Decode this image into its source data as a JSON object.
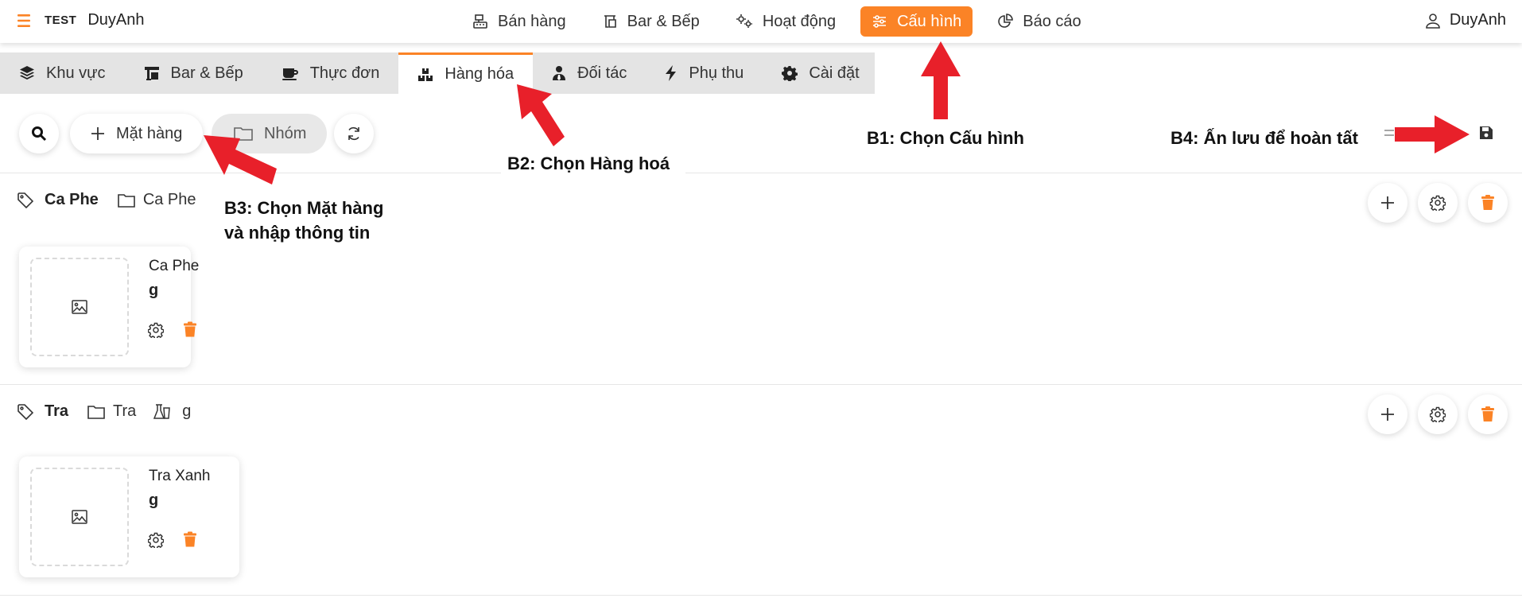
{
  "header": {
    "tag": "TEST",
    "store_name": "DuyAnh",
    "nav": [
      {
        "label": "Bán hàng",
        "icon": "cash-register-icon",
        "active": false
      },
      {
        "label": "Bar & Bếp",
        "icon": "kitchen-icon",
        "active": false
      },
      {
        "label": "Hoạt động",
        "icon": "gears-icon",
        "active": false
      },
      {
        "label": "Cấu hình",
        "icon": "sliders-icon",
        "active": true
      },
      {
        "label": "Báo cáo",
        "icon": "pie-chart-icon",
        "active": false
      }
    ],
    "user_label": "DuyAnh"
  },
  "tabs": [
    {
      "label": "Khu vực",
      "icon": "layers-icon",
      "active": false
    },
    {
      "label": "Bar & Bếp",
      "icon": "kitchen-icon",
      "active": false
    },
    {
      "label": "Thực đơn",
      "icon": "coffee-cup-icon",
      "active": false
    },
    {
      "label": "Hàng hóa",
      "icon": "boxes-icon",
      "active": true
    },
    {
      "label": "Đối tác",
      "icon": "partner-icon",
      "active": false
    },
    {
      "label": "Phụ thu",
      "icon": "bolt-icon",
      "active": false
    },
    {
      "label": "Cài đặt",
      "icon": "gear-icon",
      "active": false
    }
  ],
  "toolbar": {
    "add_item_label": "Mặt hàng",
    "group_label": "Nhóm"
  },
  "annotations": {
    "b1": "B1: Chọn Cấu hình",
    "b2": "B2: Chọn Hàng hoá",
    "b3_line1": "B3: Chọn Mặt hàng",
    "b3_line2": "và nhập thông tin",
    "b4": "B4: Ấn lưu để hoàn tất"
  },
  "groups": [
    {
      "name": "Ca Phe",
      "folder": "Ca Phe",
      "unit": "",
      "items": [
        {
          "name": "Ca Phe",
          "unit": "g"
        }
      ]
    },
    {
      "name": "Tra",
      "folder": "Tra",
      "unit": "g",
      "items": [
        {
          "name": "Tra Xanh",
          "unit": "g"
        }
      ]
    }
  ],
  "colors": {
    "accent": "#fb8326",
    "arrow": "#e8202a",
    "tab_bar": "#e4e4e4"
  }
}
